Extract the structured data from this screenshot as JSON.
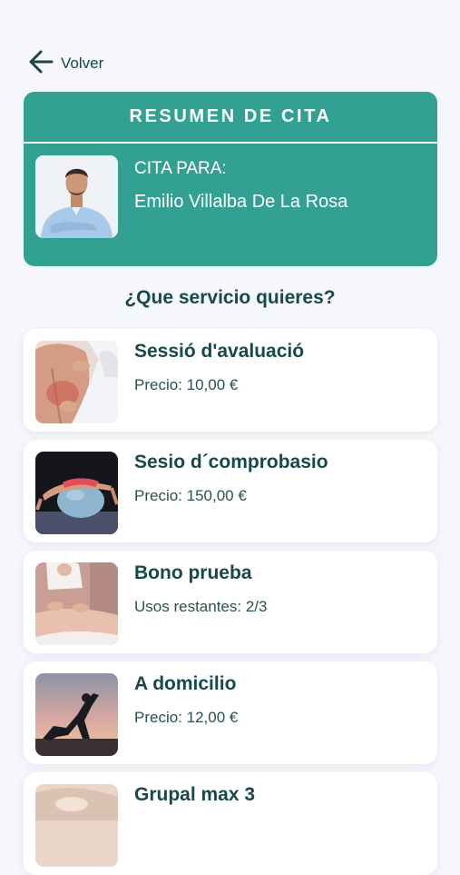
{
  "back": {
    "label": "Volver",
    "icon": "arrow-left-icon"
  },
  "summary": {
    "title": "RESUMEN DE CITA",
    "for_label": "CITA PARA:",
    "patient_name": "Emilio Villalba De La Rosa"
  },
  "question": "¿Que servicio quieres?",
  "services": [
    {
      "name": "Sessió d'avaluació",
      "detail": "Precio: 10,00 €"
    },
    {
      "name": "Sesio d´comprobasio",
      "detail": "Precio: 150,00 €"
    },
    {
      "name": "Bono prueba",
      "detail": "Usos restantes: 2/3"
    },
    {
      "name": "A domicilio",
      "detail": "Precio: 12,00 €"
    },
    {
      "name": "Grupal max 3",
      "detail": ""
    }
  ],
  "colors": {
    "accent": "#32a192",
    "text_dark": "#17494a",
    "background": "#f6f7fc"
  }
}
